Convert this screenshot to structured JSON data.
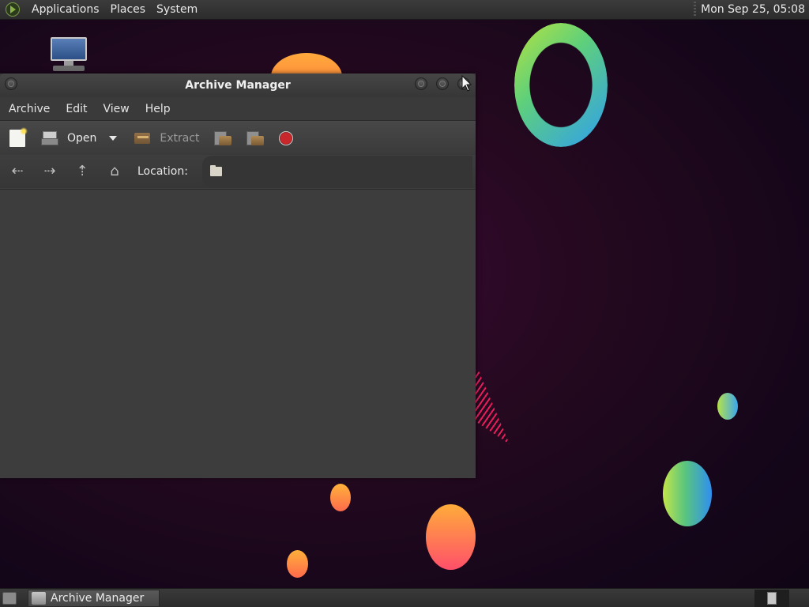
{
  "top_panel": {
    "menus": [
      "Applications",
      "Places",
      "System"
    ],
    "clock": "Mon Sep 25, 05:08"
  },
  "window": {
    "title": "Archive Manager",
    "menu": [
      "Archive",
      "Edit",
      "View",
      "Help"
    ],
    "toolbar": {
      "open_label": "Open",
      "extract_label": "Extract"
    },
    "location": {
      "label": "Location:",
      "value": ""
    }
  },
  "taskbar": {
    "task_label": "Archive Manager"
  },
  "colors": {
    "desktop_bg": "#24091f",
    "window_bg": "#3c3c3c",
    "panel_bg": "#333333"
  }
}
